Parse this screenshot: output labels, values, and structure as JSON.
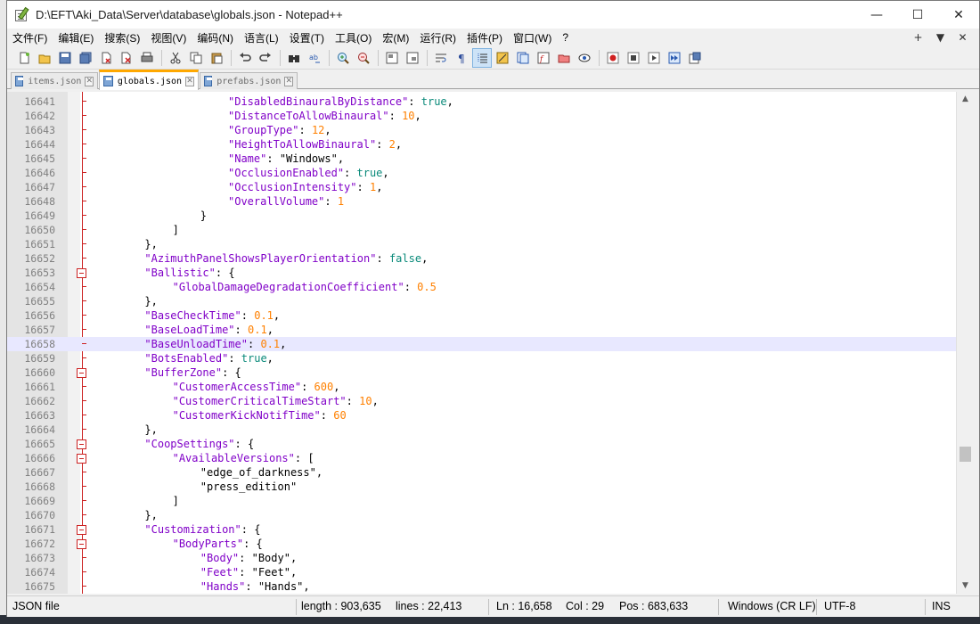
{
  "window": {
    "title": "D:\\EFT\\Aki_Data\\Server\\database\\globals.json - Notepad++",
    "controls": {
      "minimize": "—",
      "maximize": "☐",
      "close": "✕"
    }
  },
  "menu": {
    "items": [
      "文件(F)",
      "编辑(E)",
      "搜索(S)",
      "视图(V)",
      "编码(N)",
      "语言(L)",
      "设置(T)",
      "工具(O)",
      "宏(M)",
      "运行(R)",
      "插件(P)",
      "窗口(W)",
      "?"
    ],
    "right": [
      "+",
      "▼",
      "✕"
    ]
  },
  "toolbar": {
    "icons": [
      "new-file-icon",
      "open-file-icon",
      "save-icon",
      "save-all-icon",
      "close-icon",
      "close-all-icon",
      "print-icon",
      "cut-icon",
      "copy-icon",
      "paste-icon",
      "undo-icon",
      "redo-icon",
      "find-icon",
      "replace-icon",
      "zoom-in-icon",
      "zoom-out-icon",
      "sync-vertical-icon",
      "sync-horizontal-icon",
      "word-wrap-icon",
      "show-all-chars-icon",
      "indent-guide-icon",
      "udl-icon",
      "doc-map-icon",
      "function-list-icon",
      "folder-workspace-icon",
      "monitor-icon",
      "record-macro-icon",
      "stop-macro-icon",
      "play-macro-icon",
      "run-macro-multiple-icon",
      "save-macro-icon"
    ]
  },
  "tabs": [
    {
      "label": "items.json",
      "active": false
    },
    {
      "label": "globals.json",
      "active": true
    },
    {
      "label": "prefabs.json",
      "active": false
    }
  ],
  "editor": {
    "current_line": 16658,
    "lines": [
      {
        "num": "16641",
        "indent": 20,
        "tokens": [
          [
            "k",
            "\"DisabledBinauralByDistance\""
          ],
          [
            "p",
            ": "
          ],
          [
            "b",
            "true"
          ],
          [
            "p",
            ","
          ]
        ]
      },
      {
        "num": "16642",
        "indent": 20,
        "tokens": [
          [
            "k",
            "\"DistanceToAllowBinaural\""
          ],
          [
            "p",
            ": "
          ],
          [
            "n",
            "10"
          ],
          [
            "p",
            ","
          ]
        ]
      },
      {
        "num": "16643",
        "indent": 20,
        "tokens": [
          [
            "k",
            "\"GroupType\""
          ],
          [
            "p",
            ": "
          ],
          [
            "n",
            "12"
          ],
          [
            "p",
            ","
          ]
        ]
      },
      {
        "num": "16644",
        "indent": 20,
        "tokens": [
          [
            "k",
            "\"HeightToAllowBinaural\""
          ],
          [
            "p",
            ": "
          ],
          [
            "n",
            "2"
          ],
          [
            "p",
            ","
          ]
        ]
      },
      {
        "num": "16645",
        "indent": 20,
        "tokens": [
          [
            "k",
            "\"Name\""
          ],
          [
            "p",
            ": "
          ],
          [
            "s",
            "\"Windows\""
          ],
          [
            "p",
            ","
          ]
        ]
      },
      {
        "num": "16646",
        "indent": 20,
        "tokens": [
          [
            "k",
            "\"OcclusionEnabled\""
          ],
          [
            "p",
            ": "
          ],
          [
            "b",
            "true"
          ],
          [
            "p",
            ","
          ]
        ]
      },
      {
        "num": "16647",
        "indent": 20,
        "tokens": [
          [
            "k",
            "\"OcclusionIntensity\""
          ],
          [
            "p",
            ": "
          ],
          [
            "n",
            "1"
          ],
          [
            "p",
            ","
          ]
        ]
      },
      {
        "num": "16648",
        "indent": 20,
        "tokens": [
          [
            "k",
            "\"OverallVolume\""
          ],
          [
            "p",
            ": "
          ],
          [
            "n",
            "1"
          ]
        ]
      },
      {
        "num": "16649",
        "indent": 16,
        "tokens": [
          [
            "p",
            "}"
          ]
        ]
      },
      {
        "num": "16650",
        "indent": 12,
        "tokens": [
          [
            "p",
            "]"
          ]
        ]
      },
      {
        "num": "16651",
        "indent": 8,
        "tokens": [
          [
            "p",
            "},"
          ]
        ]
      },
      {
        "num": "16652",
        "indent": 8,
        "tokens": [
          [
            "k",
            "\"AzimuthPanelShowsPlayerOrientation\""
          ],
          [
            "p",
            ": "
          ],
          [
            "b",
            "false"
          ],
          [
            "p",
            ","
          ]
        ]
      },
      {
        "num": "16653",
        "indent": 8,
        "fold": true,
        "tokens": [
          [
            "k",
            "\"Ballistic\""
          ],
          [
            "p",
            ": {"
          ]
        ]
      },
      {
        "num": "16654",
        "indent": 12,
        "tokens": [
          [
            "k",
            "\"GlobalDamageDegradationCoefficient\""
          ],
          [
            "p",
            ": "
          ],
          [
            "n",
            "0.5"
          ]
        ]
      },
      {
        "num": "16655",
        "indent": 8,
        "tokens": [
          [
            "p",
            "},"
          ]
        ]
      },
      {
        "num": "16656",
        "indent": 8,
        "tokens": [
          [
            "k",
            "\"BaseCheckTime\""
          ],
          [
            "p",
            ": "
          ],
          [
            "n",
            "0.1"
          ],
          [
            "p",
            ","
          ]
        ]
      },
      {
        "num": "16657",
        "indent": 8,
        "tokens": [
          [
            "k",
            "\"BaseLoadTime\""
          ],
          [
            "p",
            ": "
          ],
          [
            "n",
            "0.1"
          ],
          [
            "p",
            ","
          ]
        ]
      },
      {
        "num": "16658",
        "indent": 8,
        "tokens": [
          [
            "k",
            "\"BaseUnloadTime\""
          ],
          [
            "p",
            ": "
          ],
          [
            "n",
            "0.1"
          ],
          [
            "p",
            ","
          ]
        ]
      },
      {
        "num": "16659",
        "indent": 8,
        "tokens": [
          [
            "k",
            "\"BotsEnabled\""
          ],
          [
            "p",
            ": "
          ],
          [
            "b",
            "true"
          ],
          [
            "p",
            ","
          ]
        ]
      },
      {
        "num": "16660",
        "indent": 8,
        "fold": true,
        "tokens": [
          [
            "k",
            "\"BufferZone\""
          ],
          [
            "p",
            ": {"
          ]
        ]
      },
      {
        "num": "16661",
        "indent": 12,
        "tokens": [
          [
            "k",
            "\"CustomerAccessTime\""
          ],
          [
            "p",
            ": "
          ],
          [
            "n",
            "600"
          ],
          [
            "p",
            ","
          ]
        ]
      },
      {
        "num": "16662",
        "indent": 12,
        "tokens": [
          [
            "k",
            "\"CustomerCriticalTimeStart\""
          ],
          [
            "p",
            ": "
          ],
          [
            "n",
            "10"
          ],
          [
            "p",
            ","
          ]
        ]
      },
      {
        "num": "16663",
        "indent": 12,
        "tokens": [
          [
            "k",
            "\"CustomerKickNotifTime\""
          ],
          [
            "p",
            ": "
          ],
          [
            "n",
            "60"
          ]
        ]
      },
      {
        "num": "16664",
        "indent": 8,
        "tokens": [
          [
            "p",
            "},"
          ]
        ]
      },
      {
        "num": "16665",
        "indent": 8,
        "fold": true,
        "tokens": [
          [
            "k",
            "\"CoopSettings\""
          ],
          [
            "p",
            ": {"
          ]
        ]
      },
      {
        "num": "16666",
        "indent": 12,
        "fold": true,
        "tokens": [
          [
            "k",
            "\"AvailableVersions\""
          ],
          [
            "p",
            ": ["
          ]
        ]
      },
      {
        "num": "16667",
        "indent": 16,
        "tokens": [
          [
            "s",
            "\"edge_of_darkness\""
          ],
          [
            "p",
            ","
          ]
        ]
      },
      {
        "num": "16668",
        "indent": 16,
        "tokens": [
          [
            "s",
            "\"press_edition\""
          ]
        ]
      },
      {
        "num": "16669",
        "indent": 12,
        "tokens": [
          [
            "p",
            "]"
          ]
        ]
      },
      {
        "num": "16670",
        "indent": 8,
        "tokens": [
          [
            "p",
            "},"
          ]
        ]
      },
      {
        "num": "16671",
        "indent": 8,
        "fold": true,
        "tokens": [
          [
            "k",
            "\"Customization\""
          ],
          [
            "p",
            ": {"
          ]
        ]
      },
      {
        "num": "16672",
        "indent": 12,
        "fold": true,
        "tokens": [
          [
            "k",
            "\"BodyParts\""
          ],
          [
            "p",
            ": {"
          ]
        ]
      },
      {
        "num": "16673",
        "indent": 16,
        "tokens": [
          [
            "k",
            "\"Body\""
          ],
          [
            "p",
            ": "
          ],
          [
            "s",
            "\"Body\""
          ],
          [
            "p",
            ","
          ]
        ]
      },
      {
        "num": "16674",
        "indent": 16,
        "tokens": [
          [
            "k",
            "\"Feet\""
          ],
          [
            "p",
            ": "
          ],
          [
            "s",
            "\"Feet\""
          ],
          [
            "p",
            ","
          ]
        ]
      },
      {
        "num": "16675",
        "indent": 16,
        "tokens": [
          [
            "k",
            "\"Hands\""
          ],
          [
            "p",
            ": "
          ],
          [
            "s",
            "\"Hands\""
          ],
          [
            "p",
            ","
          ]
        ]
      }
    ]
  },
  "status": {
    "file_type": "JSON file",
    "length": "length : 903,635",
    "lines": "lines : 22,413",
    "ln": "Ln : 16,658",
    "col": "Col : 29",
    "pos": "Pos : 683,633",
    "eol": "Windows (CR LF)",
    "encoding": "UTF-8",
    "mode": "INS"
  },
  "colors": {
    "key": "#8000c8",
    "number": "#ff8000",
    "boolean": "#0a8a7a",
    "string": "#000000",
    "current_line_bg": "#e8e8ff",
    "active_tab_accent": "#ffa800",
    "fold_margin": "#cc2222"
  }
}
